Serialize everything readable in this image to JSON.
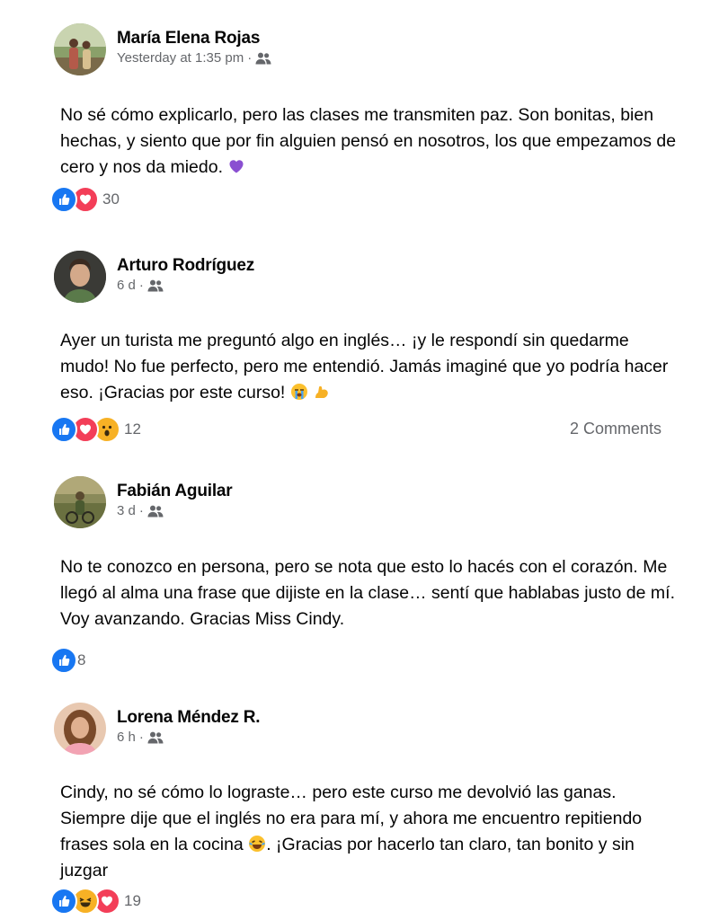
{
  "posts": [
    {
      "author": "María Elena Rojas",
      "time": "Yesterday at 1:35 pm",
      "separator": "·",
      "audience_icon": "friends-icon",
      "text_before": "No sé cómo explicarlo, pero las clases me transmiten paz. Son bonitas, bien hechas, y siento que por fin alguien pensó en nosotros, los que empezamos de cero y nos da miedo.",
      "emoji": "purple-heart",
      "reactions": [
        "like",
        "love"
      ],
      "reaction_count": "30"
    },
    {
      "author": "Arturo Rodríguez",
      "time": "6 d",
      "separator": "·",
      "audience_icon": "friends-icon",
      "text_before": "Ayer un turista me preguntó algo en inglés… ¡y le respondí sin quedarme mudo! No fue perfecto, pero me entendió. Jamás imaginé que yo podría hacer eso. ¡Gracias por este curso!",
      "emoji": "crying-face, flexed-biceps",
      "reactions": [
        "like",
        "love",
        "wow"
      ],
      "reaction_count": "12",
      "comments": "2 Comments"
    },
    {
      "author": "Fabián Aguilar",
      "time": "3 d",
      "separator": "·",
      "audience_icon": "friends-icon",
      "text_before": "No te conozco en persona, pero se nota que esto lo hacés con el corazón. Me llegó al alma una frase que dijiste en la clase… sentí que hablabas justo de mí. Voy avanzando. Gracias Miss Cindy.",
      "reactions": [
        "like"
      ],
      "reaction_count": "8"
    },
    {
      "author": "Lorena Méndez R.",
      "time": "6 h",
      "separator": "·",
      "audience_icon": "friends-icon",
      "text_before": "Cindy, no sé cómo lo lograste… pero este curso me devolvió las ganas. Siempre dije que el inglés no era para mí, y ahora me encuentro repitiendo frases sola en la cocina",
      "emoji": "laughing-face",
      "text_after": ". ¡Gracias por hacerlo tan claro, tan bonito y sin juzgar",
      "reactions": [
        "like",
        "haha",
        "love"
      ],
      "reaction_count": "19"
    }
  ],
  "colors": {
    "like": "#1877f2",
    "love": "#f33e58",
    "wow": "#f7b125",
    "secondary_text": "#65676b"
  }
}
